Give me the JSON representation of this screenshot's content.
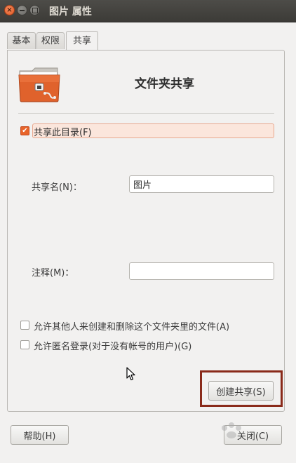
{
  "window": {
    "title": "图片 属性",
    "close_glyph": "×"
  },
  "tabs": [
    {
      "label": "基本"
    },
    {
      "label": "权限"
    },
    {
      "label": "共享",
      "active": true
    }
  ],
  "share": {
    "heading": "文件夹共享",
    "share_folder_label": "共享此目录(F)",
    "share_folder_checked": true,
    "share_name_label": "共享名(N)：",
    "share_name_value": "图片",
    "comment_label": "注释(M)：",
    "comment_value": "",
    "allow_others_label": "允许其他人来创建和删除这个文件夹里的文件(A)",
    "allow_others_checked": false,
    "guest_access_label": "允许匿名登录(对于没有帐号的用户)(G)",
    "guest_access_checked": false,
    "create_share_button": "创建共享(S)"
  },
  "footer": {
    "help_button": "帮助(H)",
    "close_button": "关闭(C)"
  },
  "colors": {
    "accent": "#e8642a",
    "titlebar": "#3c3b37",
    "highlight": "#8a2a1a",
    "window_bg": "#f2f1f0"
  },
  "icons": {
    "folder": "folder-share-icon",
    "window_close": "close-icon",
    "window_minimize": "minimize-icon",
    "window_maximize": "maximize-icon",
    "check": "check-icon",
    "cursor": "mouse-pointer-icon"
  },
  "watermark": "Baidu"
}
